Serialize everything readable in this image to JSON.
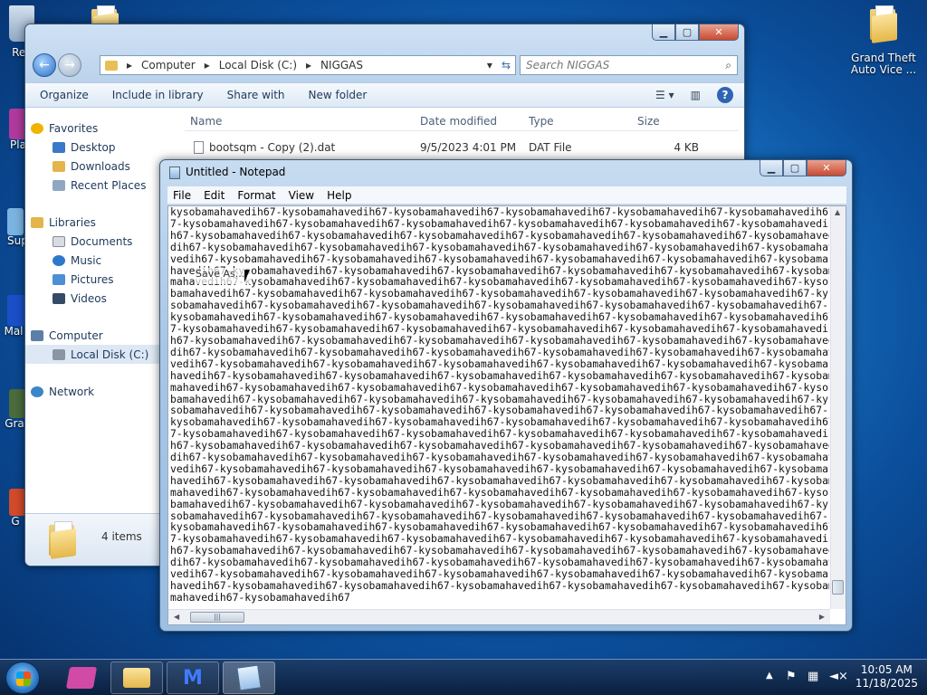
{
  "desktop": {
    "icons": [
      {
        "label": "Rec"
      },
      {
        "label": "Grand Theft Auto Vice ..."
      },
      {
        "label": "Pla"
      },
      {
        "label": "Sup"
      },
      {
        "label": "Mal"
      },
      {
        "label": "Gra"
      },
      {
        "label": "G"
      }
    ]
  },
  "explorer": {
    "breadcrumb": [
      "Computer",
      "Local Disk (C:)",
      "NIGGAS"
    ],
    "search_placeholder": "Search NIGGAS",
    "toolbar": [
      "Organize",
      "Include in library",
      "Share with",
      "New folder"
    ],
    "sidebar": {
      "favorites_header": "Favorites",
      "favorites": [
        "Desktop",
        "Downloads",
        "Recent Places"
      ],
      "libraries_header": "Libraries",
      "libraries": [
        "Documents",
        "Music",
        "Pictures",
        "Videos"
      ],
      "computer_header": "Computer",
      "computer": [
        "Local Disk (C:)"
      ],
      "network": "Network"
    },
    "columns": [
      "Name",
      "Date modified",
      "Type",
      "Size"
    ],
    "file": {
      "name": "bootsqm - Copy (2).dat",
      "date": "9/5/2023 4:01 PM",
      "type": "DAT File",
      "size": "4 KB"
    },
    "items_count": "4 items",
    "caption_min": "▁",
    "caption_max": "▢",
    "caption_close": "✕"
  },
  "notepad": {
    "title": "Untitled - Notepad",
    "menu": [
      "File",
      "Edit",
      "Format",
      "View",
      "Help"
    ],
    "context_hint": "Save As...",
    "lines": [
      "kysobamahavedih67-kysobamahavedih67-kysobamahavedih67-kysobamahavedih67-kysobamahavedih67-kysobamahavedih67-k",
      "7-kysobamahavedih67-kysobamahavedih67-kysobamahavedih67-kysobamahavedih67-kysobamahavedih67-kysobamahavedih6",
      "h67-kysobamahavedih67-kysobamahavedih67-kysobamahavedih67-kysobamahavedih67-kysobamahavedih67-kysobamahavedi",
      "dih67-kysobamahavedih67-kysobamahavedih67-kysobamahavedih67-kysobamahavedih67-kysobamahavedih67-kysobamahaved",
      "vedih67-kysobamahavedih67-kysobamahavedih67-kysobamahavedih67-kysobamahavedih67-kysobamahavedih67-kysobamahav",
      "havedih67-kysobamahavedih67-kysobamahavedih67-kysobamahavedih67-kysobamahavedih67-kysobamahavedih67-kysobamah",
      "mahavedih67-kysobamahavedih67-kysobamahavedih67-kysobamahavedih67-kysobamahavedih67-kysobamahavedih67-kysobam",
      "bamahavedih67-kysobamahavedih67-kysobamahavedih67-kysobamahavedih67-kysobamahavedih67-kysobamahavedih67-kysob",
      "sobamahavedih67-kysobamahavedih67-kysobamahavedih67-kysobamahavedih67-kysobamahavedih67-kysobamahavedih67-kys",
      "kysobamahavedih67-kysobamahavedih67-kysobamahavedih67-kysobamahavedih67-kysobamahavedih67-kysobamahavedih67-k",
      "7-kysobamahavedih67-kysobamahavedih67-kysobamahavedih67-kysobamahavedih67-kysobamahavedih67-kysobamahavedih6",
      "h67-kysobamahavedih67-kysobamahavedih67-kysobamahavedih67-kysobamahavedih67-kysobamahavedih67-kysobamahavedi",
      "dih67-kysobamahavedih67-kysobamahavedih67-kysobamahavedih67-kysobamahavedih67-kysobamahavedih67-kysobamahaved",
      "vedih67-kysobamahavedih67-kysobamahavedih67-kysobamahavedih67-kysobamahavedih67-kysobamahavedih67-kysobamahav",
      "havedih67-kysobamahavedih67-kysobamahavedih67-kysobamahavedih67-kysobamahavedih67-kysobamahavedih67-kysobamah",
      "mahavedih67-kysobamahavedih67-kysobamahavedih67-kysobamahavedih67-kysobamahavedih67-kysobamahavedih67-kysobam",
      "bamahavedih67-kysobamahavedih67-kysobamahavedih67-kysobamahavedih67-kysobamahavedih67-kysobamahavedih67-kysob",
      "sobamahavedih67-kysobamahavedih67-kysobamahavedih67-kysobamahavedih67-kysobamahavedih67-kysobamahavedih67-kys",
      "kysobamahavedih67-kysobamahavedih67-kysobamahavedih67-kysobamahavedih67-kysobamahavedih67-kysobamahavedih67-k",
      "7-kysobamahavedih67-kysobamahavedih67-kysobamahavedih67-kysobamahavedih67-kysobamahavedih67-kysobamahavedih6",
      "h67-kysobamahavedih67-kysobamahavedih67-kysobamahavedih67-kysobamahavedih67-kysobamahavedih67-kysobamahavedi",
      "dih67-kysobamahavedih67-kysobamahavedih67-kysobamahavedih67-kysobamahavedih67-kysobamahavedih67-kysobamahaved",
      "vedih67-kysobamahavedih67-kysobamahavedih67-kysobamahavedih67-kysobamahavedih67-kysobamahavedih67-kysobamahav",
      "havedih67-kysobamahavedih67-kysobamahavedih67-kysobamahavedih67-kysobamahavedih67-kysobamahavedih67-kysobamah",
      "mahavedih67-kysobamahavedih67-kysobamahavedih67-kysobamahavedih67-kysobamahavedih67-kysobamahavedih67-kysobam",
      "bamahavedih67-kysobamahavedih67-kysobamahavedih67-kysobamahavedih67-kysobamahavedih67-kysobamahavedih67-kysob",
      "sobamahavedih67-kysobamahavedih67-kysobamahavedih67-kysobamahavedih67-kysobamahavedih67-kysobamahavedih67-kys",
      "kysobamahavedih67-kysobamahavedih67-kysobamahavedih67-kysobamahavedih67-kysobamahavedih67-kysobamahavedih67-k",
      "7-kysobamahavedih67-kysobamahavedih67-kysobamahavedih67-kysobamahavedih67-kysobamahavedih67-kysobamahavedih6",
      "h67-kysobamahavedih67-kysobamahavedih67-kysobamahavedih67-kysobamahavedih67-kysobamahavedih67-kysobamahavedi",
      "dih67-kysobamahavedih67-kysobamahavedih67-kysobamahavedih67-kysobamahavedih67-kysobamahavedih67-kysobamahaved",
      "vedih67-kysobamahavedih67-kysobamahavedih67-kysobamahavedih67-kysobamahavedih67-kysobamahavedih67-kysobamahav",
      "havedih67-kysobamahavedih67-kysobamahavedih67-kysobamahavedih67-kysobamahavedih67-kysobamahavedih67-kysobamah",
      "mahavedih67-kysobamahavedih67"
    ]
  },
  "taskbar": {
    "time": "10:05 AM",
    "date": "11/18/2025"
  },
  "colors": {
    "accent": "#1a78c8",
    "close": "#c94a31"
  }
}
